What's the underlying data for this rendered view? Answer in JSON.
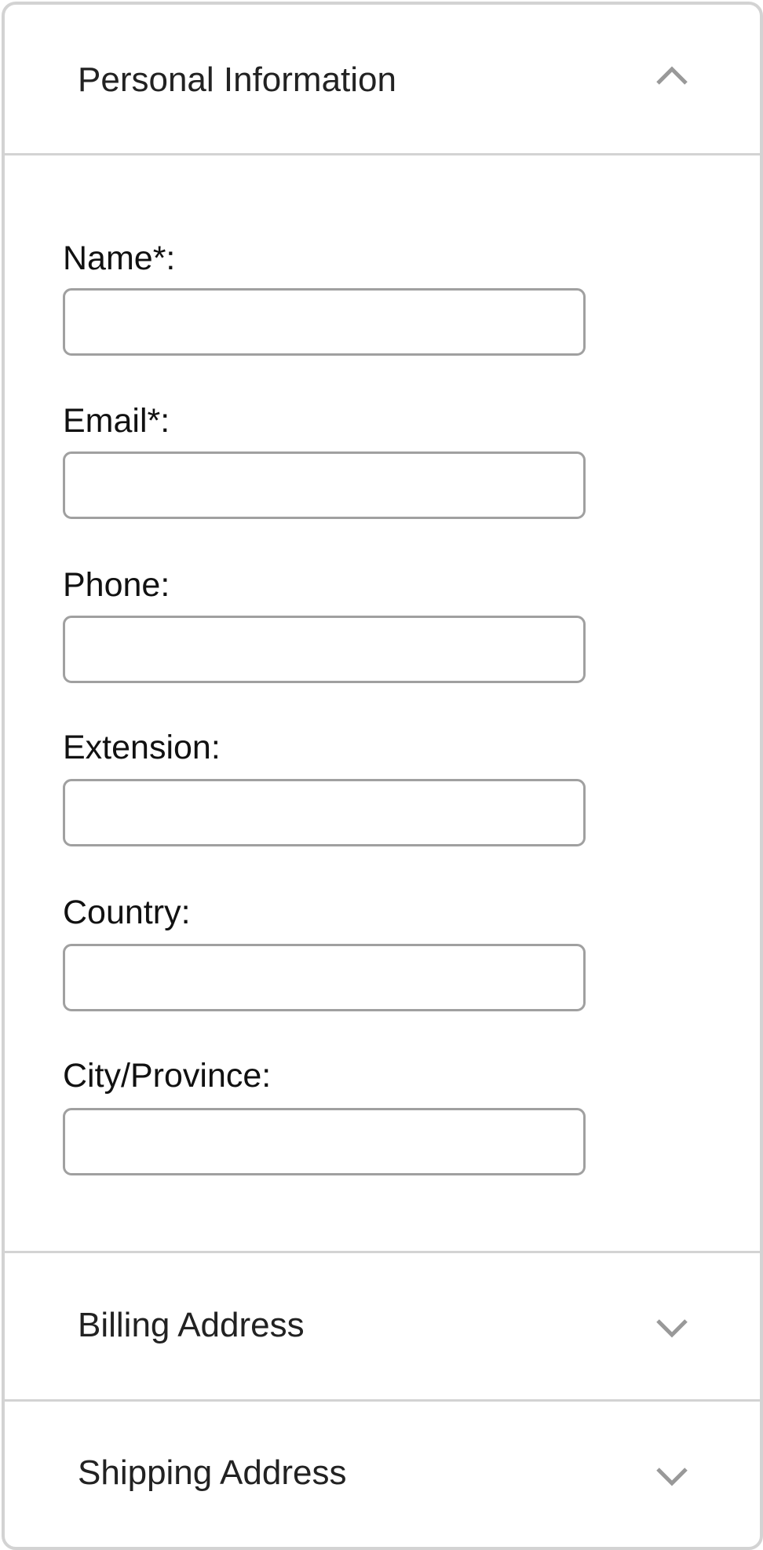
{
  "sections": [
    {
      "title": "Personal Information",
      "expanded": true,
      "icon": "chevron-up-icon"
    },
    {
      "title": "Billing Address",
      "expanded": false,
      "icon": "chevron-down-icon"
    },
    {
      "title": "Shipping Address",
      "expanded": false,
      "icon": "chevron-down-icon"
    }
  ],
  "fields": [
    {
      "label": "Name*:",
      "value": ""
    },
    {
      "label": "Email*:",
      "value": ""
    },
    {
      "label": "Phone:",
      "value": ""
    },
    {
      "label": "Extension:",
      "value": ""
    },
    {
      "label": "Country:",
      "value": ""
    },
    {
      "label": "City/Province:",
      "value": ""
    }
  ],
  "colors": {
    "border": "#d3d3d3",
    "input_border": "#a0a0a0",
    "chevron": "#999999"
  }
}
